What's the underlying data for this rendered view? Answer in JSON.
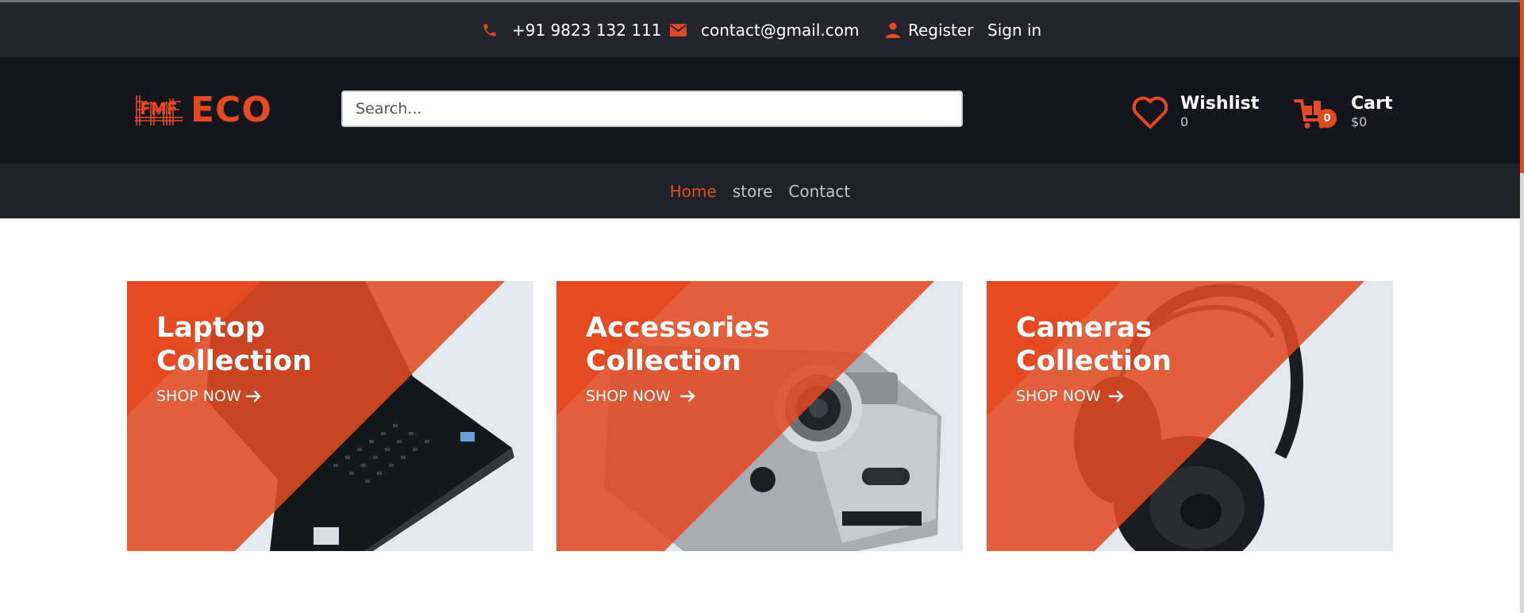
{
  "topbar": {
    "phone": "+91 9823 132 111",
    "email": "contact@gmail.com",
    "register": "Register",
    "signin": "Sign in"
  },
  "header": {
    "logo_mark": "FMF",
    "logo_text": "ECO",
    "search_placeholder": "Search...",
    "wishlist_label": "Wishlist",
    "wishlist_count": "0",
    "cart_label": "Cart",
    "cart_total": "$0",
    "cart_badge": "0"
  },
  "nav": {
    "home": "Home",
    "store": "store",
    "contact": "Contact"
  },
  "collections": [
    {
      "line1": "Laptop",
      "line2": "Collection",
      "cta": "SHOP NOW",
      "icon": "laptop-image"
    },
    {
      "line1": "Accessories",
      "line2": "Collection",
      "cta": "SHOP NOW",
      "icon": "camera-image"
    },
    {
      "line1": "Cameras",
      "line2": "Collection",
      "cta": "SHOP NOW",
      "icon": "headphones-image"
    }
  ],
  "colors": {
    "accent": "#e34a22",
    "topbar": "#23242c",
    "header": "#15161d",
    "nav": "#20222a",
    "card_bg": "#e6e8ef"
  }
}
